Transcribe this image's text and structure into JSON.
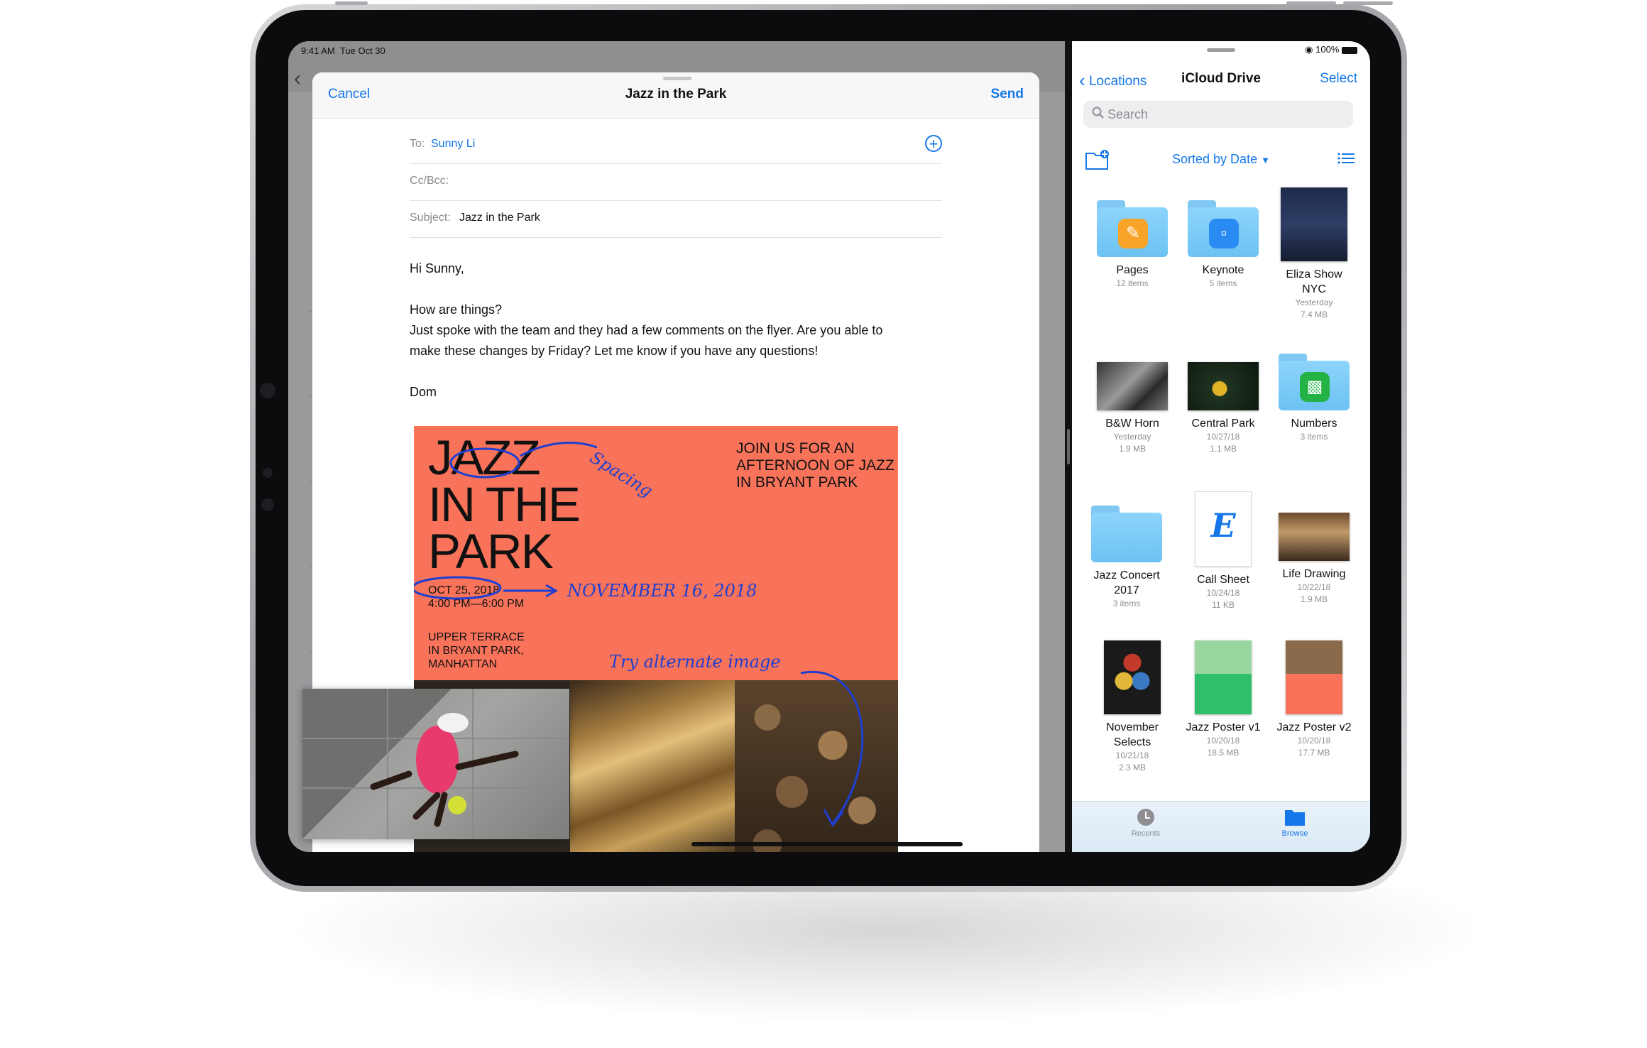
{
  "status": {
    "time": "9:41 AM",
    "date": "Tue Oct 30",
    "battery": "100%"
  },
  "compose": {
    "cancel": "Cancel",
    "title": "Jazz in the Park",
    "send": "Send",
    "to_label": "To:",
    "to_value": "Sunny Li",
    "cc_label": "Cc/Bcc:",
    "subject_label": "Subject:",
    "subject_value": "Jazz in the Park",
    "greeting": "Hi Sunny,",
    "line1": "How are things?",
    "line2": "Just spoke with the team and they had a few comments on the flyer. Are you able to",
    "line3": "make these changes by Friday? Let me know if you have any questions!",
    "signature": "Dom"
  },
  "poster": {
    "headline_1": "JAZZ",
    "headline_2": "IN THE",
    "headline_3": "PARK",
    "join_1": "JOIN US FOR AN",
    "join_2": "AFTERNOON OF JAZZ",
    "join_3": "IN BRYANT PARK",
    "date": "OCT 25, 2018",
    "time": "4:00 PM—6:00 PM",
    "loc_1": "UPPER TERRACE",
    "loc_2": "IN BRYANT PARK,",
    "loc_3": "MANHATTAN",
    "note_spacing": "Spacing",
    "note_date": "NOVEMBER 16, 2018",
    "note_image": "Try alternate image"
  },
  "files": {
    "back": "Locations",
    "title": "iCloud Drive",
    "select": "Select",
    "search_placeholder": "Search",
    "sort": "Sorted by Date",
    "items": [
      {
        "name": "Pages",
        "meta1": "12 items",
        "meta2": "",
        "meta3": ""
      },
      {
        "name": "Keynote",
        "meta1": "5 items",
        "meta2": "",
        "meta3": ""
      },
      {
        "name": "Eliza Show",
        "name2": "NYC",
        "meta1": "Yesterday",
        "meta2": "7.4 MB",
        "meta3": ""
      },
      {
        "name": "B&W Horn",
        "meta1": "Yesterday",
        "meta2": "1.9 MB"
      },
      {
        "name": "Central Park",
        "meta1": "10/27/18",
        "meta2": "1.1 MB"
      },
      {
        "name": "Numbers",
        "meta1": "3 items",
        "meta2": ""
      },
      {
        "name": "Jazz Concert",
        "name2": "2017",
        "meta1": "3 items",
        "meta2": ""
      },
      {
        "name": "Call Sheet",
        "meta1": "10/24/18",
        "meta2": "11 KB"
      },
      {
        "name": "Life Drawing",
        "meta1": "10/22/18",
        "meta2": "1.9 MB"
      },
      {
        "name": "November",
        "name2": "Selects",
        "meta1": "10/21/18",
        "meta2": "2.3 MB"
      },
      {
        "name": "Jazz Poster v1",
        "meta1": "10/20/18",
        "meta2": "18.5 MB"
      },
      {
        "name": "Jazz Poster v2",
        "meta1": "10/20/18",
        "meta2": "17.7 MB"
      }
    ],
    "tab_recents": "Recents",
    "tab_browse": "Browse",
    "call_sheet_glyph": "E"
  },
  "colors": {
    "accent": "#1577e8",
    "poster": "#f9735a",
    "annotation": "#1e3fd0"
  }
}
